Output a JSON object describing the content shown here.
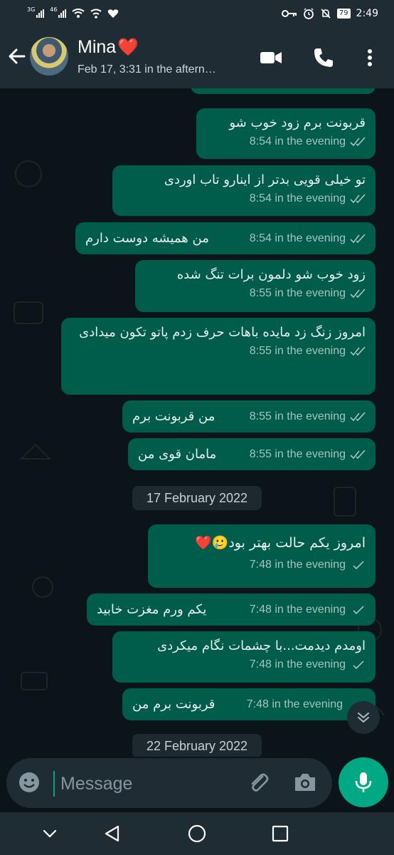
{
  "status_bar": {
    "left_labels": [
      "3G",
      "46"
    ],
    "time": "2:49",
    "battery": "79",
    "icons": [
      "signal-icon",
      "wifi-icon",
      "heart-icon",
      "key-icon",
      "alarm-icon",
      "bell-off-icon",
      "battery-icon"
    ]
  },
  "header": {
    "back_icon": "arrow-left-icon",
    "contact_name": "Mina",
    "contact_emoji": "❤️",
    "subtitle": "Feb 17, 3:31 in the aftern…",
    "video_icon": "video-call-icon",
    "call_icon": "phone-icon",
    "menu_icon": "more-vert-icon"
  },
  "messages": [
    {
      "text": "قربونت برم زود خوب شو",
      "time": "8:54 in the evening",
      "status": "read"
    },
    {
      "text": "تو خیلی قویی بدتر از اینارو تاب اوردی",
      "time": "8:54 in the evening",
      "status": "read"
    },
    {
      "text": "من همیشه دوست دارم",
      "time": "8:54 in the evening",
      "status": "read"
    },
    {
      "text": "زود خوب شو دلمون برات تنگ شده",
      "time": "8:55 in the evening",
      "status": "read"
    },
    {
      "text": "امروز زنگ زد مایده باهات حرف زدم پاتو تکون میدادی",
      "time": "8:55 in the evening",
      "status": "read"
    },
    {
      "text": "من قربونت برم",
      "time": "8:55 in the evening",
      "status": "read"
    },
    {
      "text": "مامان قوی من",
      "time": "8:55 in the evening",
      "status": "read"
    },
    {
      "text": "امروز یکم حالت بهتر بود🥲❤️",
      "time": "7:48 in the evening",
      "status": "delivered"
    },
    {
      "text": "یکم ورم مغزت خابید",
      "time": "7:48 in the evening",
      "status": "delivered"
    },
    {
      "text": "اومدم دیدمت...با چشمات نگام میکردی",
      "time": "7:48 in the evening",
      "status": "delivered"
    },
    {
      "text": "قربونت برم من",
      "time": "7:48 in the evening",
      "status": "delivered"
    }
  ],
  "date_separators": [
    "17 February 2022",
    "22 February 2022"
  ],
  "composer": {
    "placeholder": "Message",
    "emoji_icon": "emoji-icon",
    "attach_icon": "paperclip-icon",
    "camera_icon": "camera-icon",
    "mic_icon": "mic-icon"
  },
  "nav_bar": {
    "icons": [
      "chevron-down-icon",
      "back-triangle-icon",
      "home-circle-icon",
      "recents-square-icon"
    ]
  },
  "colors": {
    "bubble_out": "#005c4b",
    "header_bg": "#1f2c33",
    "accent": "#00a884",
    "tick_read": "#a8c3bd"
  }
}
